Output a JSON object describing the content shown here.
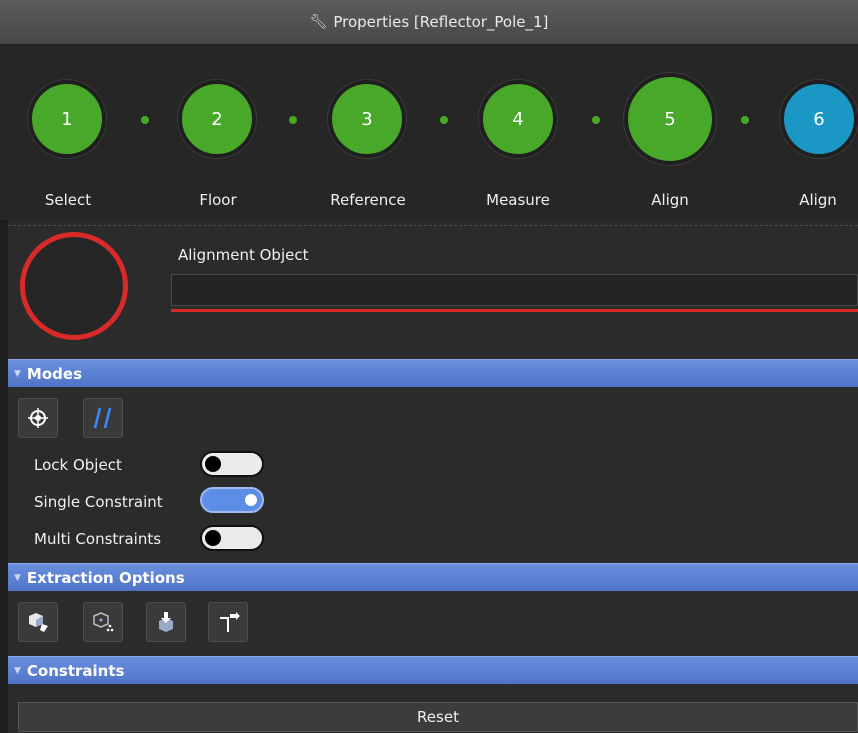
{
  "window": {
    "title": "Properties [Reflector_Pole_1]"
  },
  "wizard": {
    "steps": [
      {
        "number": "1",
        "label": "Select",
        "state": "complete"
      },
      {
        "number": "2",
        "label": "Floor",
        "state": "complete"
      },
      {
        "number": "3",
        "label": "Reference",
        "state": "complete"
      },
      {
        "number": "4",
        "label": "Measure",
        "state": "complete"
      },
      {
        "number": "5",
        "label": "Align",
        "state": "current"
      },
      {
        "number": "6",
        "label": "Align",
        "state": "pending"
      }
    ]
  },
  "alignment": {
    "label": "Alignment Object",
    "value": ""
  },
  "modes": {
    "header": "Modes",
    "icons": [
      "target-icon",
      "parallel-lines-icon"
    ],
    "toggles": [
      {
        "label": "Lock Object",
        "on": false
      },
      {
        "label": "Single Constraint",
        "on": true
      },
      {
        "label": "Multi Constraints",
        "on": false
      }
    ]
  },
  "extraction": {
    "header": "Extraction Options",
    "icons": [
      "cube-extract-icon",
      "cube-points-icon",
      "cube-down-arrow-icon",
      "corner-arrow-icon"
    ]
  },
  "constraints": {
    "header": "Constraints"
  },
  "reset": {
    "label": "Reset"
  },
  "colors": {
    "complete": "#48a82a",
    "current": "#48a82a",
    "pending": "#1a97c4",
    "error": "#d92a2a",
    "section": "#5a7fd2"
  }
}
